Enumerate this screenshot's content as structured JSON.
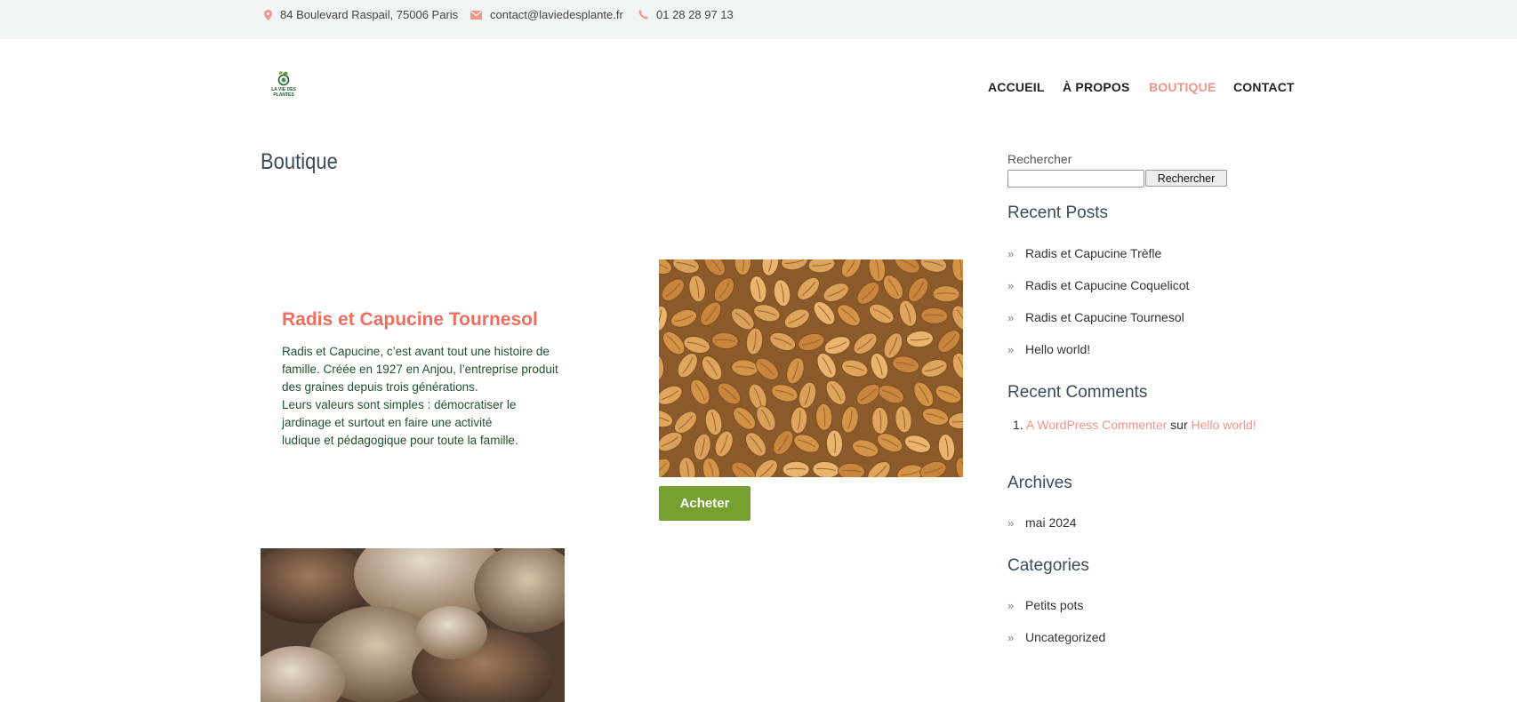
{
  "topbar": {
    "address": "84 Boulevard Raspail, 75006 Paris",
    "email": "contact@laviedesplante.fr",
    "phone": "01 28 28 97 13",
    "icons": [
      "map-marker-icon",
      "envelope-icon",
      "phone-icon"
    ]
  },
  "brand": {
    "logo_line1": "LA VIE DES",
    "logo_line2": "PLANTES"
  },
  "nav": {
    "items": [
      {
        "label": "ACCUEIL"
      },
      {
        "label": "À PROPOS"
      },
      {
        "label": "BOUTIQUE",
        "active": true
      },
      {
        "label": "CONTACT"
      }
    ]
  },
  "main": {
    "title": "Boutique",
    "product": {
      "title": "Radis et Capucine Tournesol",
      "desc_lines": [
        "Radis et Capucine, c’est avant tout une histoire de",
        "famille. Créée en 1927 en Anjou, l’entreprise produit",
        "des graines depuis trois générations.",
        "Leurs valeurs sont simples : démocratiser le",
        "jardinage et surtout en faire une activité",
        "ludique et pédagogique pour toute la famille."
      ],
      "buy_label": "Acheter"
    }
  },
  "sidebar": {
    "search_label": "Rechercher",
    "search_button": "Rechercher",
    "search_value": "",
    "recent_posts_title": "Recent Posts",
    "recent_posts": [
      "Radis et Capucine Trèfle",
      "Radis et Capucine Coquelicot",
      "Radis et Capucine Tournesol",
      "Hello world!"
    ],
    "recent_comments_title": "Recent Comments",
    "comment": {
      "author": "A WordPress Commenter",
      "sep": "sur",
      "post": "Hello world!"
    },
    "archives_title": "Archives",
    "archives": [
      "mai 2024"
    ],
    "categories_title": "Categories",
    "categories": [
      "Petits pots",
      "Uncategorized"
    ]
  },
  "colors": {
    "accent": "#f0958a",
    "product_title": "#ee6e5f",
    "button": "#76a030",
    "desc_text": "#215236",
    "topbar_bg": "#f2f5f4"
  }
}
